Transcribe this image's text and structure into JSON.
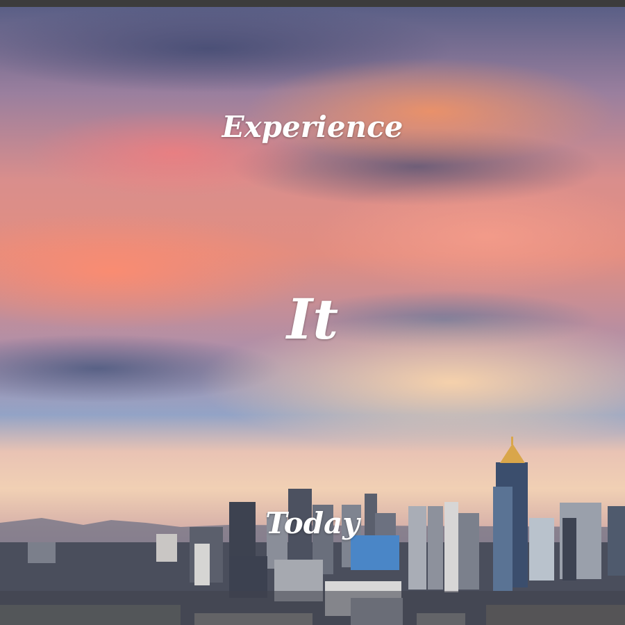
{
  "hero": {
    "line1": "Experience",
    "line2": "It",
    "line3": "Today"
  },
  "background": {
    "image": "city-skyline-sunset",
    "sky_colors": [
      "#5a5f86",
      "#e28d80",
      "#93a3c6",
      "#f1d0b4"
    ],
    "city_color": "#3b3f4c"
  }
}
